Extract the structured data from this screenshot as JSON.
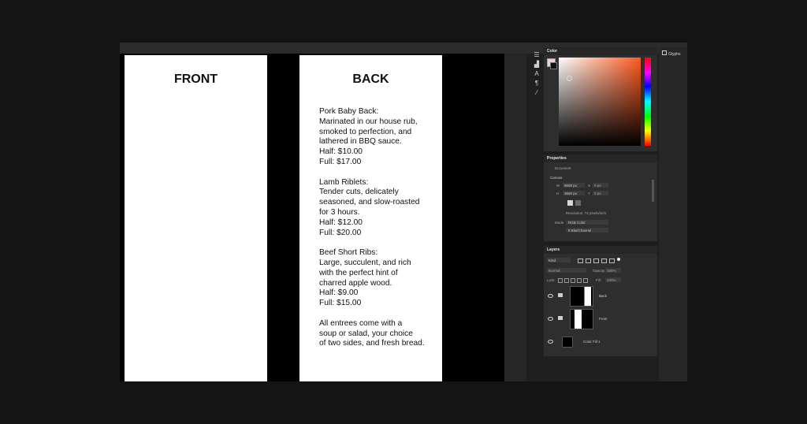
{
  "canvas": {
    "front": {
      "title": "FRONT"
    },
    "back": {
      "title": "BACK",
      "items": [
        {
          "lines": [
            "Pork Baby Back:",
            "Marinated in our house rub,",
            "smoked to perfection, and",
            "lathered in BBQ sauce.",
            "Half: $10.00",
            "Full: $17.00"
          ]
        },
        {
          "lines": [
            "Lamb Riblets:",
            "Tender cuts, delicately",
            "seasoned, and slow-roasted",
            "for 3 hours.",
            "Half: $12.00",
            "Full: $20.00"
          ]
        },
        {
          "lines": [
            "Beef Short Ribs:",
            "Large, succulent, and rich",
            "with the perfect hint of",
            "charred apple wood.",
            "Half: $9.00",
            "Full: $15.00"
          ]
        },
        {
          "lines": [
            "All entrees come with a",
            "soup or salad, your choice",
            "of two sides, and fresh bread."
          ]
        }
      ]
    }
  },
  "panels": {
    "color": {
      "title": "Color",
      "fg_color": "#e8d4d4",
      "bg_color": "#111111"
    },
    "properties": {
      "title": "Properties",
      "document_label": "Document",
      "canvas_section": "Canvas",
      "w_label": "W",
      "w_value": "9000 px",
      "h_label": "H",
      "h_value": "3600 px",
      "x_label": "X",
      "x_value": "0 px",
      "y_label": "Y",
      "y_value": "0 px",
      "resolution": "Resolution: 72 pixels/inch",
      "mode_label": "Mode",
      "mode_value": "RGB Color",
      "depth_value": "8 Bits/Channel"
    },
    "layers": {
      "title": "Layers",
      "kind_filter": "Kind",
      "blend_mode": "Normal",
      "opacity_label": "Opacity:",
      "opacity_value": "100%",
      "lock_label": "Lock:",
      "fill_label": "Fill:",
      "fill_value": "100%",
      "rows": [
        {
          "name": "Back"
        },
        {
          "name": "Front"
        },
        {
          "name": "Color Fill 1"
        }
      ]
    }
  },
  "right_column": {
    "glyphs_label": "Glyphs"
  }
}
